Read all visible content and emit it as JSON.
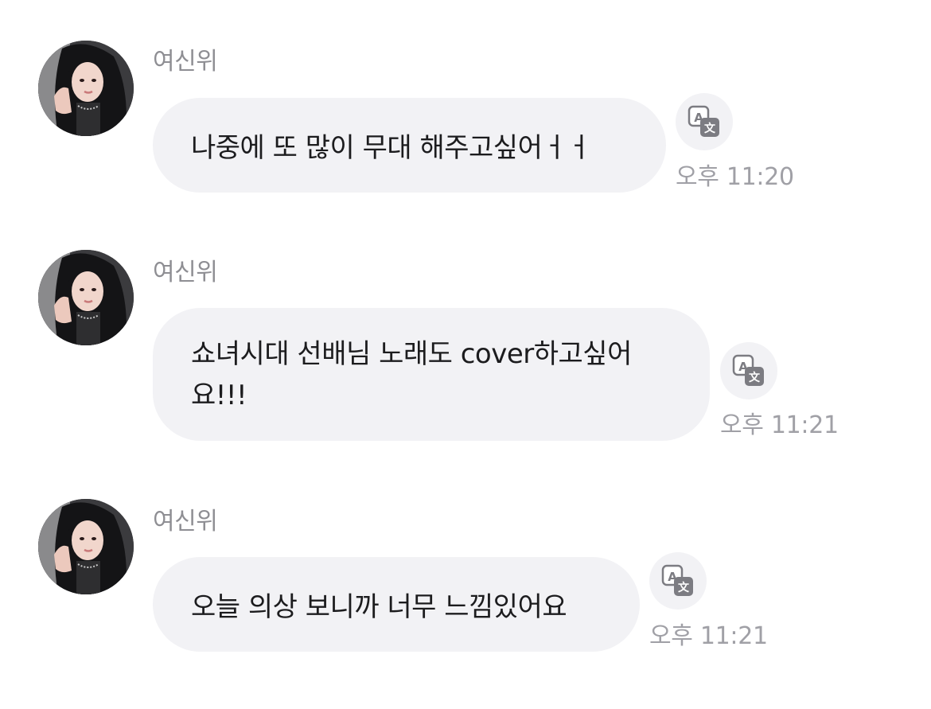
{
  "messages": [
    {
      "sender": "여신위",
      "text": "나중에 또 많이 무대 해주고싶어ㅓㅓ",
      "time": "오후 11:20",
      "translate_icon": "translate-icon"
    },
    {
      "sender": "여신위",
      "text": "쇼녀시대 선배님 노래도 cover하고싶어요!!!",
      "time": "오후 11:21",
      "translate_icon": "translate-icon"
    },
    {
      "sender": "여신위",
      "text": "오늘 의상 보니까 너무 느낌있어요",
      "time": "오후 11:21",
      "translate_icon": "translate-icon"
    }
  ],
  "colors": {
    "bubble_bg": "#f2f2f5",
    "text": "#1c1c1e",
    "muted": "#8e8e93",
    "time": "#a0a0a6"
  }
}
